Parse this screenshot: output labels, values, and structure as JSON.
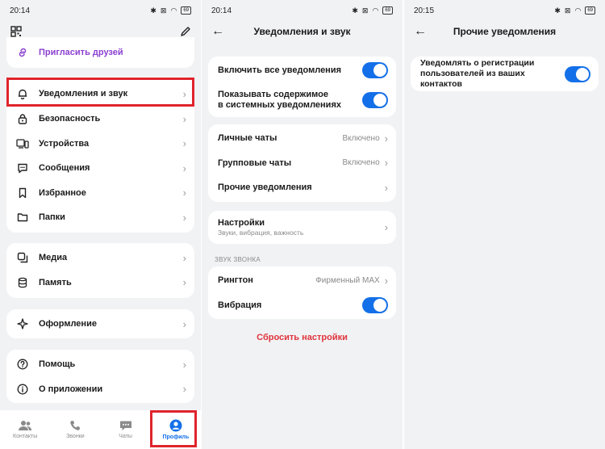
{
  "colors": {
    "accent": "#1470e8",
    "danger": "#e0343c",
    "highlight": "#e0242c"
  },
  "screen1": {
    "time": "20:14",
    "battery": "69",
    "invite": {
      "label": "Пригласить друзей",
      "icon": "link-icon"
    },
    "menu_group1": [
      {
        "label": "Уведомления и звук",
        "icon": "bell-icon"
      },
      {
        "label": "Безопасность",
        "icon": "lock-icon"
      },
      {
        "label": "Устройства",
        "icon": "devices-icon"
      },
      {
        "label": "Сообщения",
        "icon": "chat-bubble-icon"
      },
      {
        "label": "Избранное",
        "icon": "bookmark-icon"
      },
      {
        "label": "Папки",
        "icon": "folder-icon"
      }
    ],
    "menu_group2": [
      {
        "label": "Медиа",
        "icon": "media-icon"
      },
      {
        "label": "Память",
        "icon": "database-icon"
      }
    ],
    "menu_group3": [
      {
        "label": "Оформление",
        "icon": "palette-icon"
      }
    ],
    "menu_group4": [
      {
        "label": "Помощь",
        "icon": "help-icon"
      },
      {
        "label": "О приложении",
        "icon": "info-icon"
      }
    ],
    "tabs": [
      {
        "label": "Контакты",
        "icon": "contacts-icon"
      },
      {
        "label": "Звонки",
        "icon": "phone-icon"
      },
      {
        "label": "Чаты",
        "icon": "chats-icon"
      },
      {
        "label": "Профиль",
        "icon": "profile-icon"
      }
    ]
  },
  "screen2": {
    "time": "20:14",
    "battery": "69",
    "title": "Уведомления и звук",
    "toggles": [
      {
        "label": "Включить все уведомления",
        "on": true
      },
      {
        "label": "Показывать содержимое в системных уведомлениях",
        "line1": "Показывать содержимое",
        "line2": "в системных уведомлениях",
        "on": true
      }
    ],
    "chats": [
      {
        "label": "Личные чаты",
        "value": "Включено"
      },
      {
        "label": "Групповые чаты",
        "value": "Включено"
      },
      {
        "label": "Прочие уведомления",
        "value": ""
      }
    ],
    "settings": {
      "label": "Настройки",
      "sublabel": "Звуки, вибрация, важность"
    },
    "ring_section": "ЗВУК ЗВОНКА",
    "ringtone": {
      "label": "Рингтон",
      "value": "Фирменный MAX"
    },
    "vibration": {
      "label": "Вибрация",
      "on": true
    },
    "reset": "Сбросить настройки"
  },
  "screen3": {
    "time": "20:15",
    "battery": "69",
    "title": "Прочие уведомления",
    "toggle": {
      "line1": "Уведомлять о регистрации",
      "line2": "пользователей из ваших контактов",
      "on": true
    }
  }
}
